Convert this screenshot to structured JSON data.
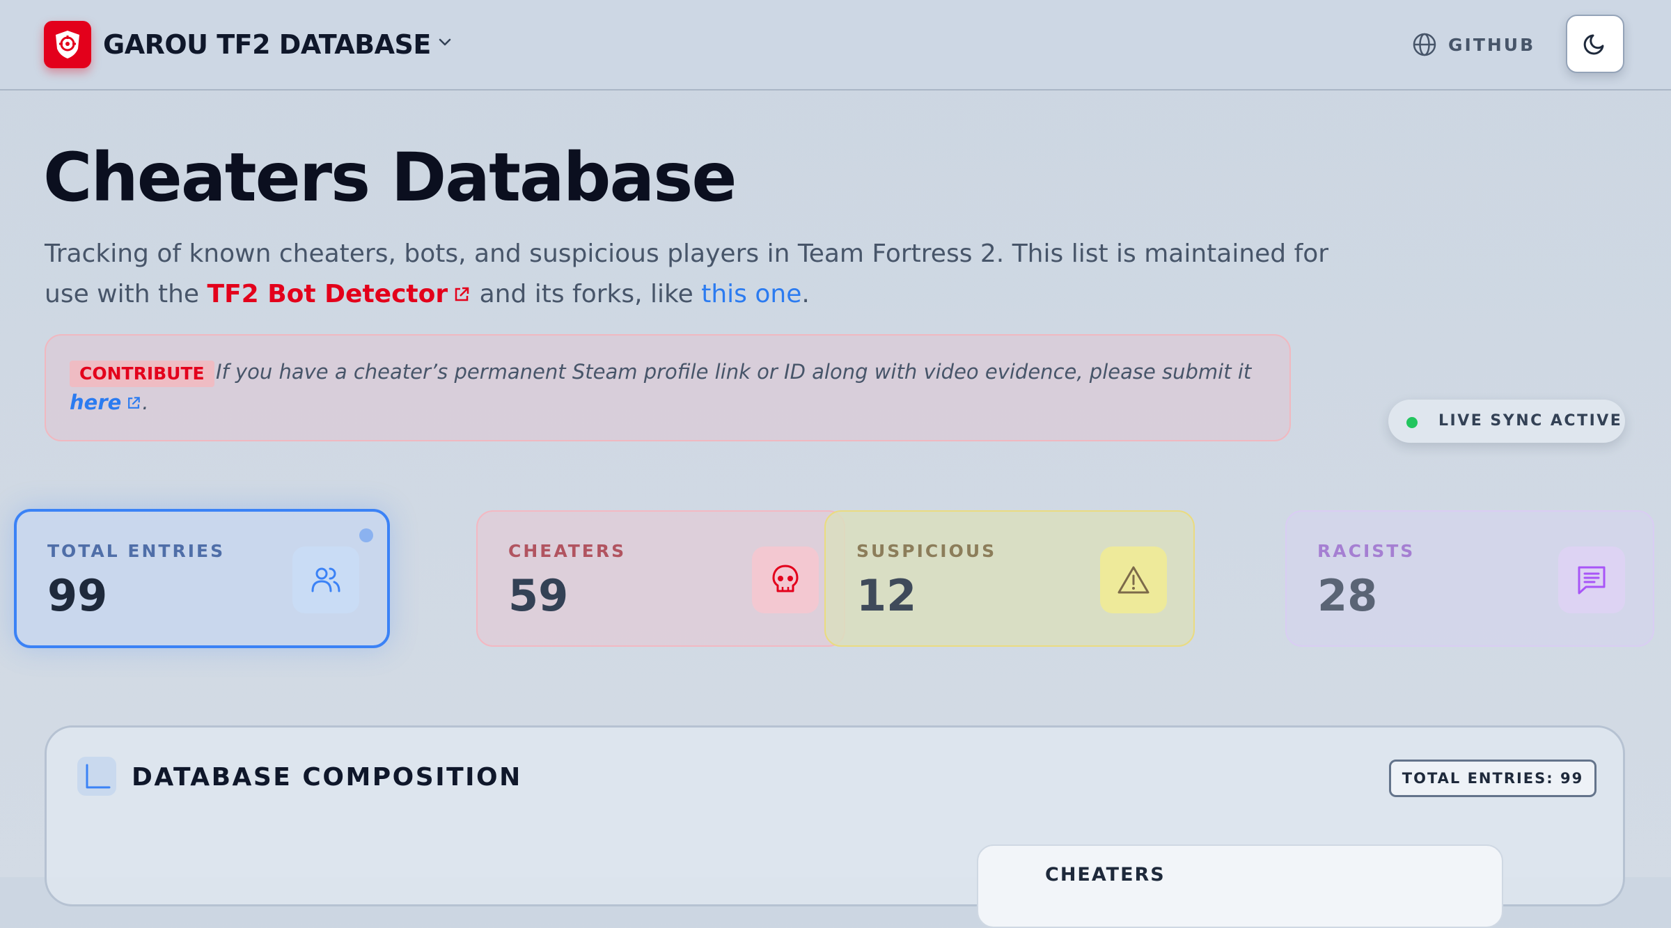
{
  "header": {
    "brand": "GAROU TF2 DATABASE",
    "github_label": "GITHUB"
  },
  "hero": {
    "title": "Cheaters Database",
    "intro_part1": "Tracking of known cheaters, bots, and suspicious players in Team Fortress 2. This list is maintained for use with the ",
    "bot_detector_link": "TF2 Bot Detector",
    "intro_part2": " and its forks, like ",
    "fork_link": "this one",
    "intro_part3": "."
  },
  "contribute": {
    "badge": "CONTRIBUTE",
    "text": "If you have a cheater’s permanent Steam profile link or ID along with video evidence, please submit it ",
    "link": "here",
    "end": "."
  },
  "sync": {
    "label": "LIVE SYNC ACTIVE",
    "status_color": "#22c55e"
  },
  "stats": [
    {
      "label": "TOTAL ENTRIES",
      "value": "99",
      "icon": "users-icon"
    },
    {
      "label": "CHEATERS",
      "value": "59",
      "icon": "skull-icon"
    },
    {
      "label": "SUSPICIOUS",
      "value": "12",
      "icon": "warning-icon"
    },
    {
      "label": "RACISTS",
      "value": "28",
      "icon": "chat-icon"
    }
  ],
  "composition": {
    "title": "DATABASE COMPOSITION",
    "total_badge": "TOTAL ENTRIES: 99",
    "legend_first": "CHEATERS"
  },
  "colors": {
    "brand_red": "#e3001b",
    "link_blue": "#2b7bf0",
    "accent_blue": "#3b82f6"
  }
}
